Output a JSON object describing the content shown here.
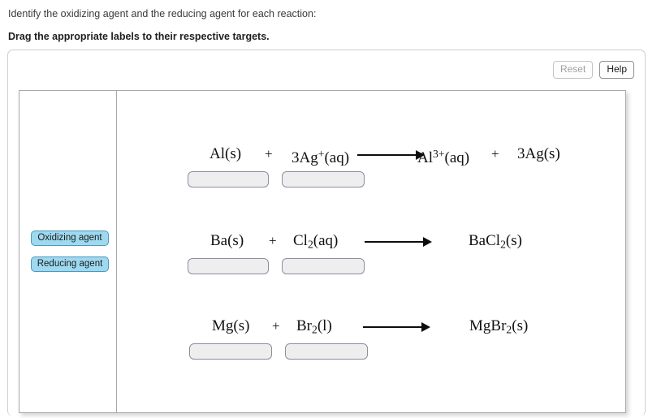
{
  "prompt": {
    "line1": "Identify the oxidizing agent and the reducing agent for each reaction:",
    "line2": "Drag the appropriate labels to their respective targets."
  },
  "toolbar": {
    "reset_label": "Reset",
    "help_label": "Help",
    "reset_state": "disabled",
    "help_state": "enabled"
  },
  "label_bank": {
    "items": [
      {
        "label": "Oxidizing agent",
        "name": "drag-label-oxidizing-agent"
      },
      {
        "label": "Reducing agent",
        "name": "drag-label-reducing-agent"
      }
    ]
  },
  "colors": {
    "label_fill": "#9ed9f0",
    "label_border": "#4f97bb",
    "drop_fill": "#eeeeee",
    "drop_border": "#8d8da3",
    "canvas_border": "#a8a8a8",
    "panel_border": "#cfcfcf"
  },
  "reactions": [
    {
      "id": "reaction-1",
      "reactant1": "Al(s)",
      "reactant1_html": "Al(s)",
      "operator": "+",
      "reactant2_html": "3Ag<sup>+</sup>(aq)",
      "product1_html": "Al<sup>3+</sup>(aq)",
      "product_operator": "+",
      "product2_html": "3Ag(s)",
      "drop_targets": [
        "",
        ""
      ]
    },
    {
      "id": "reaction-2",
      "reactant1_html": "Ba(s)",
      "operator": "+",
      "reactant2_html": "Cl<sub>2</sub>(aq)",
      "product1_html": "BaCl<sub>2</sub>(s)",
      "product_operator": "",
      "product2_html": "",
      "drop_targets": [
        "",
        ""
      ]
    },
    {
      "id": "reaction-3",
      "reactant1_html": "Mg(s)",
      "operator": "+",
      "reactant2_html": "Br<sub>2</sub>(l)",
      "product1_html": "MgBr<sub>2</sub>(s)",
      "product_operator": "",
      "product2_html": "",
      "drop_targets": [
        "",
        ""
      ]
    }
  ]
}
